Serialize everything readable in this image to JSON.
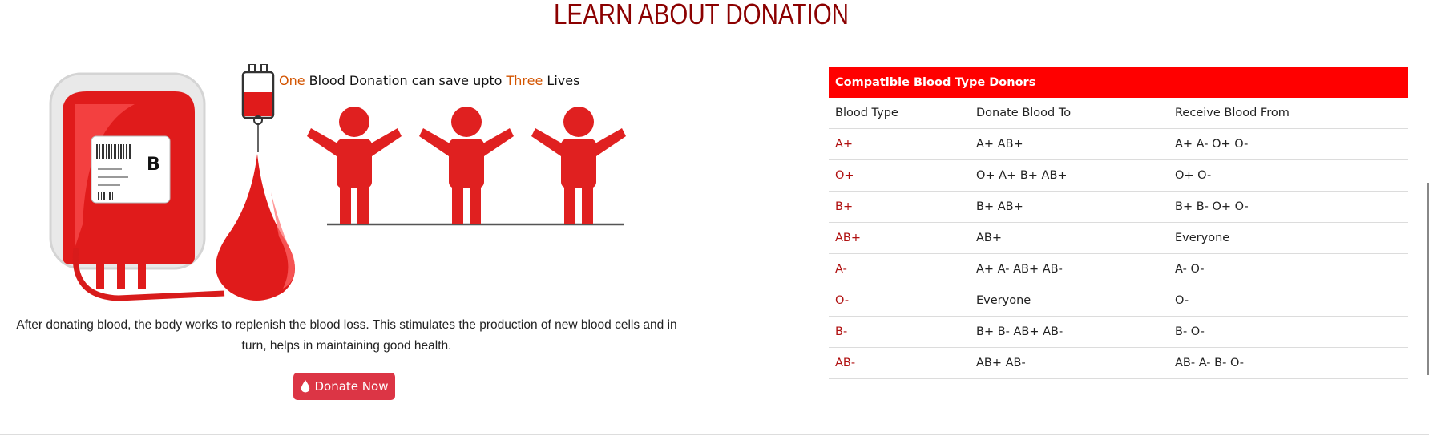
{
  "section": {
    "title": "LEARN ABOUT DONATION"
  },
  "illustration": {
    "bag_label": "B",
    "slogan_one": "One",
    "slogan_middle": " Blood Donation can save upto ",
    "slogan_three": "Three",
    "slogan_end": " Lives"
  },
  "caption": "After donating blood, the body works to replenish the blood loss. This stimulates the production of new blood cells and in turn, helps in maintaining good health.",
  "donate_button": {
    "label": "Donate Now",
    "icon": "blood-drop-icon"
  },
  "table": {
    "title": "Compatible Blood Type Donors",
    "headers": [
      "Blood Type",
      "Donate Blood To",
      "Receive Blood From"
    ],
    "rows": [
      {
        "type": "A+",
        "donate": "A+ AB+",
        "receive": "A+ A- O+ O-"
      },
      {
        "type": "O+",
        "donate": "O+ A+ B+ AB+",
        "receive": "O+ O-"
      },
      {
        "type": "B+",
        "donate": "B+ AB+",
        "receive": "B+ B- O+ O-"
      },
      {
        "type": "AB+",
        "donate": "AB+",
        "receive": "Everyone"
      },
      {
        "type": "A-",
        "donate": "A+ A- AB+ AB-",
        "receive": "A- O-"
      },
      {
        "type": "O-",
        "donate": "Everyone",
        "receive": "O-"
      },
      {
        "type": "B-",
        "donate": "B+ B- AB+ AB-",
        "receive": "B- O-"
      },
      {
        "type": "AB-",
        "donate": "AB+ AB-",
        "receive": "AB- A- B- O-"
      }
    ]
  },
  "colors": {
    "title": "#8b0000",
    "accent_red": "#ff0000",
    "button": "#dc3545",
    "slogan_orange": "#d35400",
    "type_red": "#b01010"
  }
}
